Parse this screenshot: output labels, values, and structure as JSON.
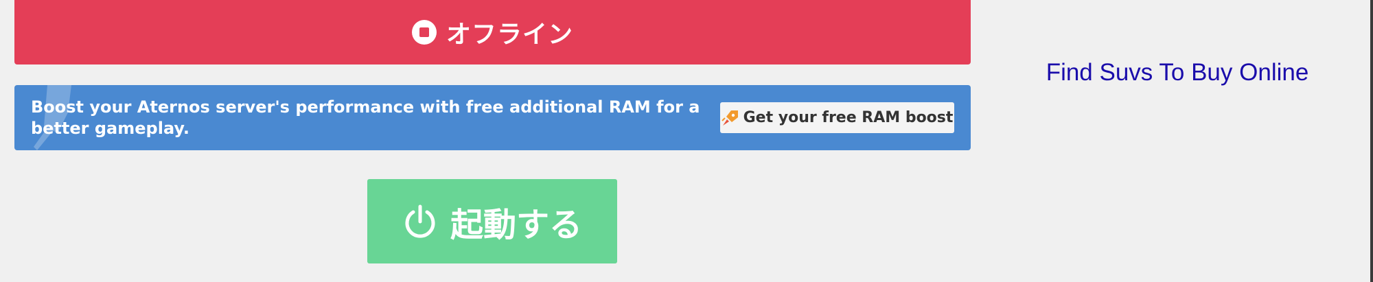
{
  "status": {
    "label": "オフライン",
    "icon": "stop-circle-icon",
    "color": "#e43e57"
  },
  "ram_banner": {
    "text": "Boost your Aternos server's performance with free additional RAM for a better gameplay.",
    "button_label": "Get your free RAM boost",
    "button_icon": "rocket-icon",
    "color": "#4a89d1"
  },
  "start_button": {
    "label": "起動する",
    "icon": "power-icon",
    "color": "#68d595"
  },
  "sidebar_ad": {
    "link_text": "Find Suvs To Buy Online",
    "color": "#1a0dab"
  }
}
